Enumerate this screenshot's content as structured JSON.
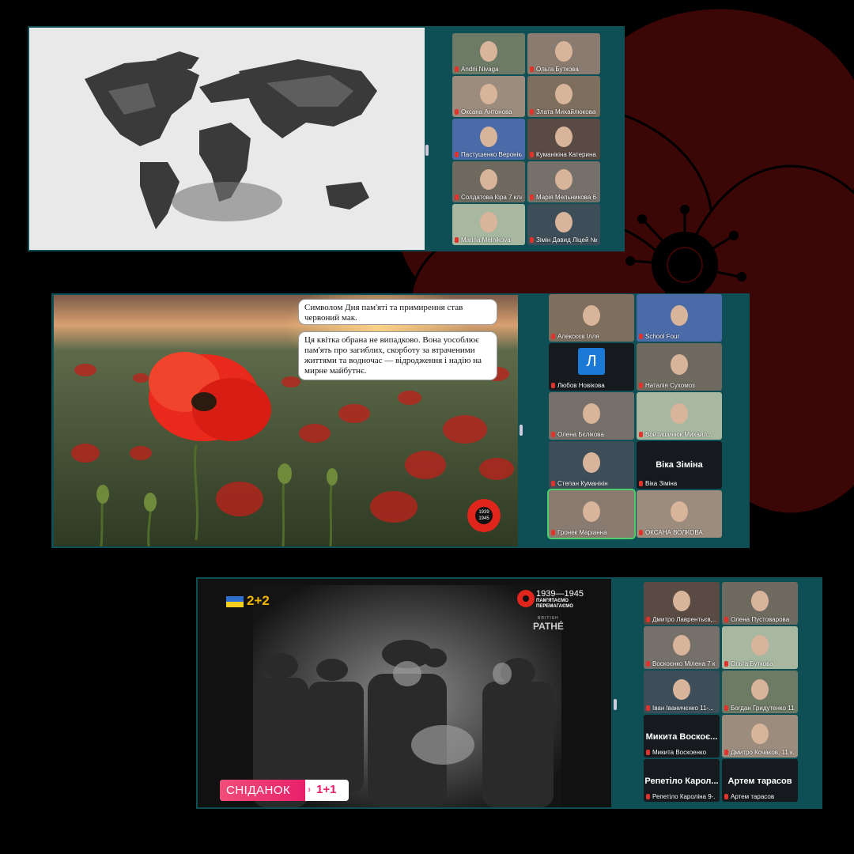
{
  "colors": {
    "background": "#000000",
    "poppy": "#3a0606",
    "strip": "#0e4f55",
    "mic_muted": "#e2332a",
    "active_speaker_border": "#4ccf6a"
  },
  "panel1": {
    "participants": [
      {
        "name": "Andrii Nivaga"
      },
      {
        "name": "Ольга Буткова"
      },
      {
        "name": "Оксана Антонова"
      },
      {
        "name": "Злата Михайлюкова"
      },
      {
        "name": "Пастушенко Вероніка"
      },
      {
        "name": "Куманікіна Катерина"
      },
      {
        "name": "Солдатова Кіра 7 кла..."
      },
      {
        "name": "Марія Мельникова 6-А"
      },
      {
        "name": "Marina Melnikova"
      },
      {
        "name": "Зімін Давид Ліцей №..."
      }
    ]
  },
  "panel2": {
    "bubble1": "Символом Дня пам'яті та примирення став червоний мак.",
    "bubble2": "Ця квітка обрана не випадково. Вона уособлює пам'ять про загиблих, скорботу за втраченими життями та водночас — відродження і надію на мирне майбутнє.",
    "badge_years": [
      "1939",
      "1945"
    ],
    "participants": [
      {
        "name": "Алексєєв Ілля"
      },
      {
        "name": "School Four"
      },
      {
        "name": "Любов Новікова",
        "initial": "Л"
      },
      {
        "name": "Наталія Сухомоз"
      },
      {
        "name": "Олена Бєлікова"
      },
      {
        "name": "Войтишинюк Михайл..."
      },
      {
        "name": "Степан Куманікін"
      },
      {
        "name": "Віка Зіміна",
        "big": "Віка Зіміна"
      },
      {
        "name": "Гронек Маріанна"
      },
      {
        "name": "ОКСАНА ВОЛКОВА"
      }
    ]
  },
  "panel3": {
    "channel_logo": "2+2",
    "remembrance": {
      "years": "1939—1945",
      "line1": "ПАМ'ЯТАЄМО",
      "line2": "ПЕРЕМАГАЄМО"
    },
    "archive_small": "BRITISH",
    "archive": "PATHÉ",
    "show_title": "СНІДАНОК",
    "show_with": "з",
    "show_channel": "1+1",
    "participants": [
      {
        "name": "Дмитро Лаврентьєв,..."
      },
      {
        "name": "Олена Пустоварова"
      },
      {
        "name": "Воскоєнко Мілена 7 к..."
      },
      {
        "name": "Ольга Буткова"
      },
      {
        "name": "Іван Іваничєнко 11-..."
      },
      {
        "name": "Богдан Гридутенко 11..."
      },
      {
        "name": "Микита Воскоенко",
        "big": "Микита Воскоє..."
      },
      {
        "name": "Дмитро Кочаков, 11 к..."
      },
      {
        "name": "Репетіло Кароліна 9-...",
        "big": "Репетіло Карол..."
      },
      {
        "name": "Артем тарасов",
        "big": "Артем тарасов"
      }
    ]
  }
}
